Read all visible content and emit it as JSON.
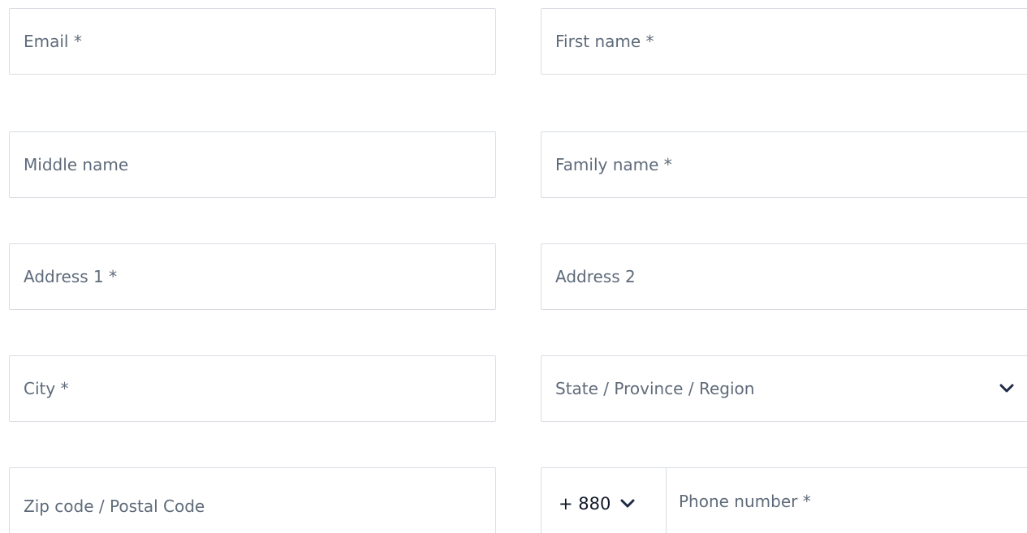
{
  "form": {
    "email": {
      "placeholder": "Email *",
      "value": ""
    },
    "first_name": {
      "placeholder": "First name *",
      "value": ""
    },
    "middle_name": {
      "placeholder": "Middle name",
      "value": ""
    },
    "family_name": {
      "placeholder": "Family name *",
      "value": ""
    },
    "address1": {
      "placeholder": "Address 1 *",
      "value": ""
    },
    "address2": {
      "placeholder": "Address 2",
      "value": ""
    },
    "city": {
      "placeholder": "City *",
      "value": ""
    },
    "state": {
      "selected_label": "State / Province / Region",
      "icon": "chevron-down-icon"
    },
    "zip": {
      "placeholder": "Zip code / Postal Code",
      "value": ""
    },
    "phone": {
      "dial_code": "+ 880",
      "dial_icon": "chevron-down-icon",
      "placeholder": "Phone number *",
      "value": ""
    }
  },
  "colors": {
    "border": "#d9dde3",
    "placeholder": "#5f6b7a",
    "text": "#111827",
    "chevron": "#1f2a44"
  }
}
